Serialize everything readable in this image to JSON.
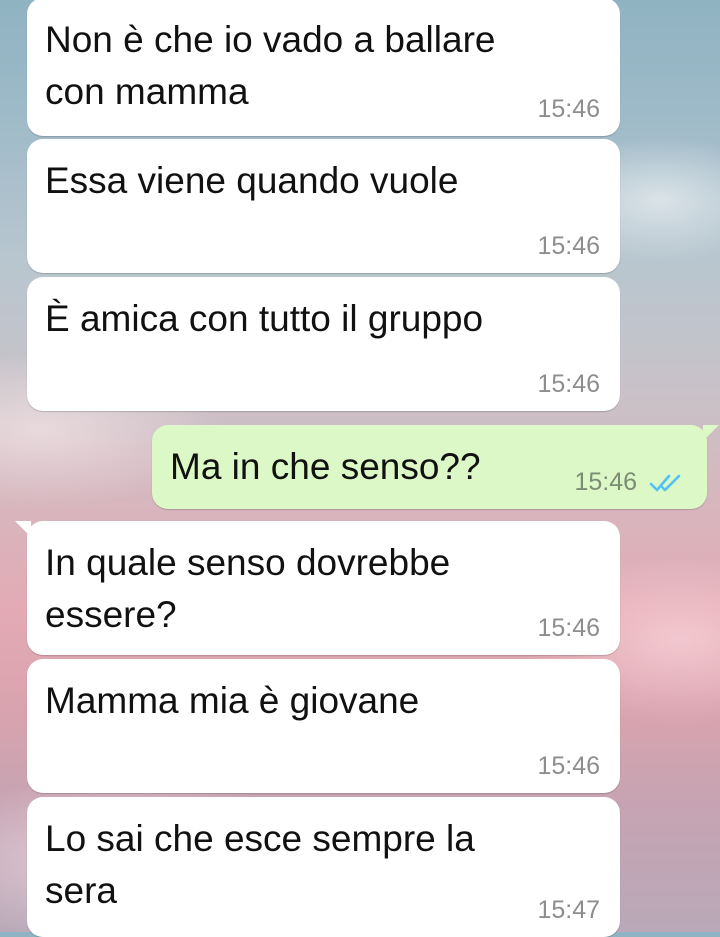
{
  "messages": [
    {
      "direction": "incoming",
      "text": "Non è che io vado a ballare\ncon mamma",
      "time": "15:46"
    },
    {
      "direction": "incoming",
      "text": "Essa viene quando vuole",
      "time": "15:46"
    },
    {
      "direction": "incoming",
      "text": "È amica con tutto il gruppo",
      "time": "15:46"
    },
    {
      "direction": "outgoing",
      "text": "Ma in che senso??",
      "time": "15:46",
      "status": "read"
    },
    {
      "direction": "incoming",
      "text": "In quale senso dovrebbe\nessere?",
      "time": "15:46"
    },
    {
      "direction": "incoming",
      "text": "Mamma mia è giovane",
      "time": "15:46"
    },
    {
      "direction": "incoming",
      "text": "Lo sai che esce sempre la\nsera",
      "time": "15:47"
    }
  ],
  "colors": {
    "incoming_bubble": "#ffffff",
    "outgoing_bubble": "#dcf8c6",
    "read_ticks": "#4fc3f7"
  },
  "icons": {
    "read_receipt": "double-check-icon"
  }
}
